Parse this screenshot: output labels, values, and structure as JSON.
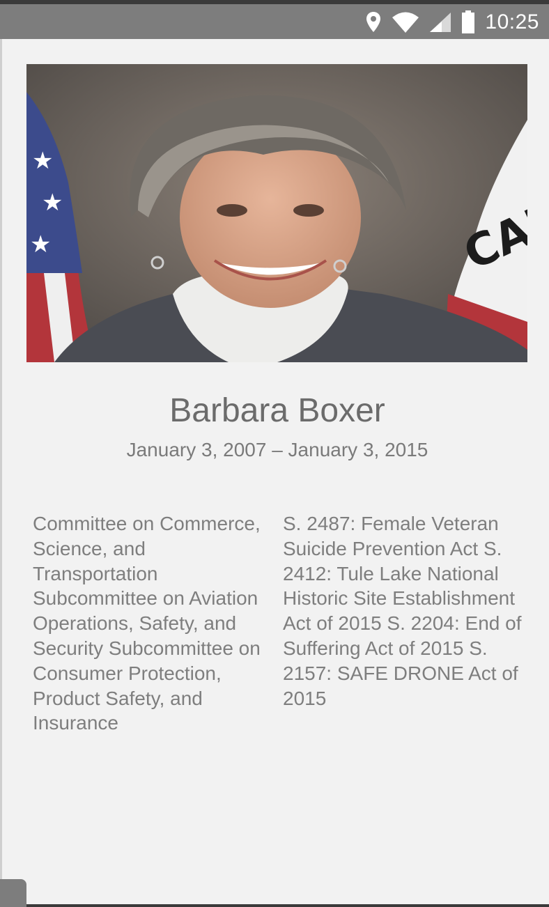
{
  "status_bar": {
    "time": "10:25",
    "icons": [
      "location-icon",
      "wifi-icon",
      "cell-signal-icon",
      "battery-icon"
    ]
  },
  "profile": {
    "photo_alt": "Barbara Boxer",
    "name": "Barbara Boxer",
    "term": "January 3, 2007 – January 3, 2015"
  },
  "committees": {
    "text": "Committee on Commerce, Science, and Transportation Subcommittee on Aviation Operations, Safety, and Security Subcommittee on Consumer Protection, Product Safety, and Insurance"
  },
  "bills": {
    "text": "S. 2487: Female Veteran Suicide Prevention Act S. 2412: Tule Lake National Historic Site Establishment Act of 2015 S. 2204: End of Suffering Act of 2015 S. 2157: SAFE DRONE Act of 2015"
  },
  "colors": {
    "status_bar": "#7d7d7d",
    "background": "#f2f2f2",
    "name_text": "#6b6b6b",
    "body_text": "#7e7e7e"
  }
}
